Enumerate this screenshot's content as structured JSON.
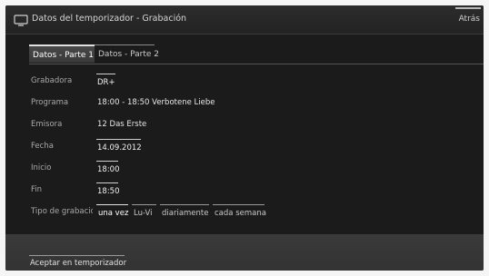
{
  "header": {
    "title": "Datos del temporizador - Grabación",
    "back_label": "Atrás",
    "icon": "tv-icon"
  },
  "tabs": [
    {
      "label": "Datos - Parte 1",
      "active": true
    },
    {
      "label": "Datos - Parte 2",
      "active": false
    }
  ],
  "fields": {
    "recorder": {
      "label": "Grabadora",
      "value": "DR+"
    },
    "program": {
      "label": "Programa",
      "value": "18:00 - 18:50 Verbotene Liebe"
    },
    "station": {
      "label": "Emisora",
      "value": "12 Das Erste"
    },
    "date": {
      "label": "Fecha",
      "value": "14.09.2012"
    },
    "start": {
      "label": "Inicio",
      "value": "18:00"
    },
    "end": {
      "label": "Fin",
      "value": "18:50"
    },
    "recording_type": {
      "label": "Tipo de grabación",
      "options": [
        "una vez",
        "Lu-Vi",
        "diariamente",
        "cada semana"
      ],
      "selected": "una vez"
    }
  },
  "footer": {
    "accept_label": "Aceptar en temporizador"
  }
}
